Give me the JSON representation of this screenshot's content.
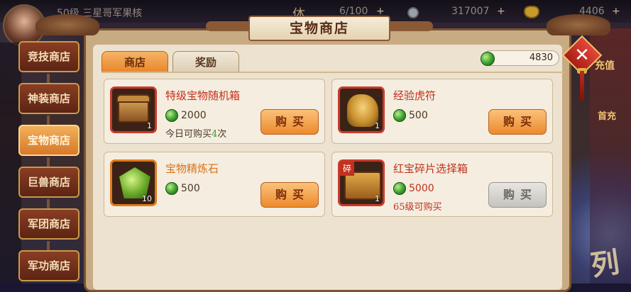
{
  "topbar": {
    "player_name": "50级 三星哥军果核",
    "stamina_icon": "体",
    "stamina": "6/100",
    "silver": "317007",
    "gold": "4406"
  },
  "sidebar": {
    "items": [
      {
        "label": "竞技商店",
        "active": false
      },
      {
        "label": "神装商店",
        "active": false
      },
      {
        "label": "宝物商店",
        "active": true
      },
      {
        "label": "巨兽商店",
        "active": false
      },
      {
        "label": "军团商店",
        "active": false
      },
      {
        "label": "军功商店",
        "active": false
      }
    ]
  },
  "panel": {
    "title": "宝物商店",
    "tabs": [
      {
        "label": "商店",
        "active": true
      },
      {
        "label": "奖励",
        "active": false
      }
    ],
    "currency": {
      "icon": "jade-icon",
      "value": "4830"
    }
  },
  "items": [
    {
      "name": "特级宝物随机箱",
      "price": "2000",
      "limit_prefix": "今日可购买",
      "limit_num": "4",
      "limit_suffix": "次",
      "count": "1",
      "button": "购买",
      "rarity": "red"
    },
    {
      "name": "经验虎符",
      "price": "500",
      "count": "1",
      "button": "购买",
      "rarity": "red"
    },
    {
      "name": "宝物精炼石",
      "price": "500",
      "count": "10",
      "button": "购买",
      "rarity": "orange"
    },
    {
      "name": "红宝碎片选择箱",
      "price": "5000",
      "limit": "65级可购买",
      "count": "1",
      "button": "购买",
      "rarity": "red",
      "frag_tag": "碎",
      "button_disabled": true
    }
  ],
  "right_deco": {
    "recharge": "充值",
    "first_pay": "首充",
    "big_char": "列"
  },
  "colors": {
    "accent": "#ec8a2c",
    "rare_red": "#c2301b",
    "rare_orange": "#d9721a",
    "jade": "#3a9e2c"
  }
}
